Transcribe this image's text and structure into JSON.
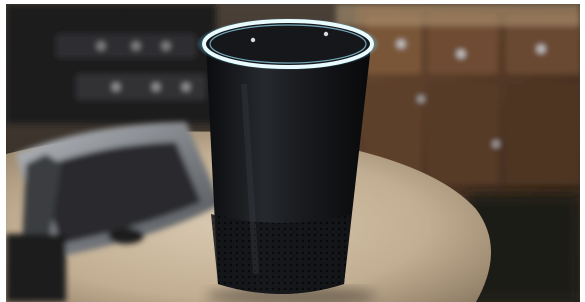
{
  "scene": {
    "subject": "smart-speaker",
    "colors": {
      "speaker_body": "#17191c",
      "light_ring": "#e8fbff",
      "light_ring_glow": "#67d6ff",
      "countertop": "#c9b79d",
      "cabinets": "#5a3d28",
      "sink_steel": "#8f9398",
      "border": "#ffffff"
    },
    "icons": [
      "light-ring-icon",
      "microphone-hole-icon",
      "speaker-grille-icon"
    ]
  }
}
